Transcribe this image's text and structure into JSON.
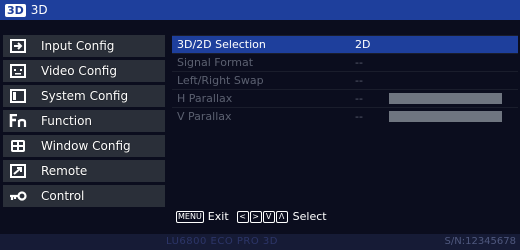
{
  "header": {
    "badge": "3D",
    "title": "3D"
  },
  "sidebar": {
    "items": [
      {
        "label": "Input Config",
        "icon": "input-icon"
      },
      {
        "label": "Video Config",
        "icon": "video-icon"
      },
      {
        "label": "System Config",
        "icon": "system-icon"
      },
      {
        "label": "Function",
        "icon": "function-icon"
      },
      {
        "label": "Window Config",
        "icon": "window-icon"
      },
      {
        "label": "Remote",
        "icon": "remote-icon"
      },
      {
        "label": "Control",
        "icon": "key-icon"
      }
    ]
  },
  "settings": {
    "rows": [
      {
        "name": "3D/2D Selection",
        "value": "2D",
        "active": true
      },
      {
        "name": "Signal Format",
        "value": "--",
        "active": false
      },
      {
        "name": "Left/Right Swap",
        "value": "--",
        "active": false
      },
      {
        "name": "H Parallax",
        "value": "--",
        "active": false,
        "bar": true
      },
      {
        "name": "V Parallax",
        "value": "--",
        "active": false,
        "bar": true
      }
    ]
  },
  "hint": {
    "menu_key": "MENU",
    "exit_label": "Exit",
    "nav_keys": [
      "<",
      ">",
      "V",
      "Λ"
    ],
    "select_label": "Select"
  },
  "footer": {
    "model": "LU6800 ECO PRO 3D",
    "serial": "S/N:12345678"
  },
  "colors": {
    "accent": "#1e3f9c",
    "sidebar_item_bg": "#2a2f39",
    "sidebar_item_border": "#c9cbd1",
    "disabled_text": "#5b6070",
    "background": "#0b0d1e"
  }
}
